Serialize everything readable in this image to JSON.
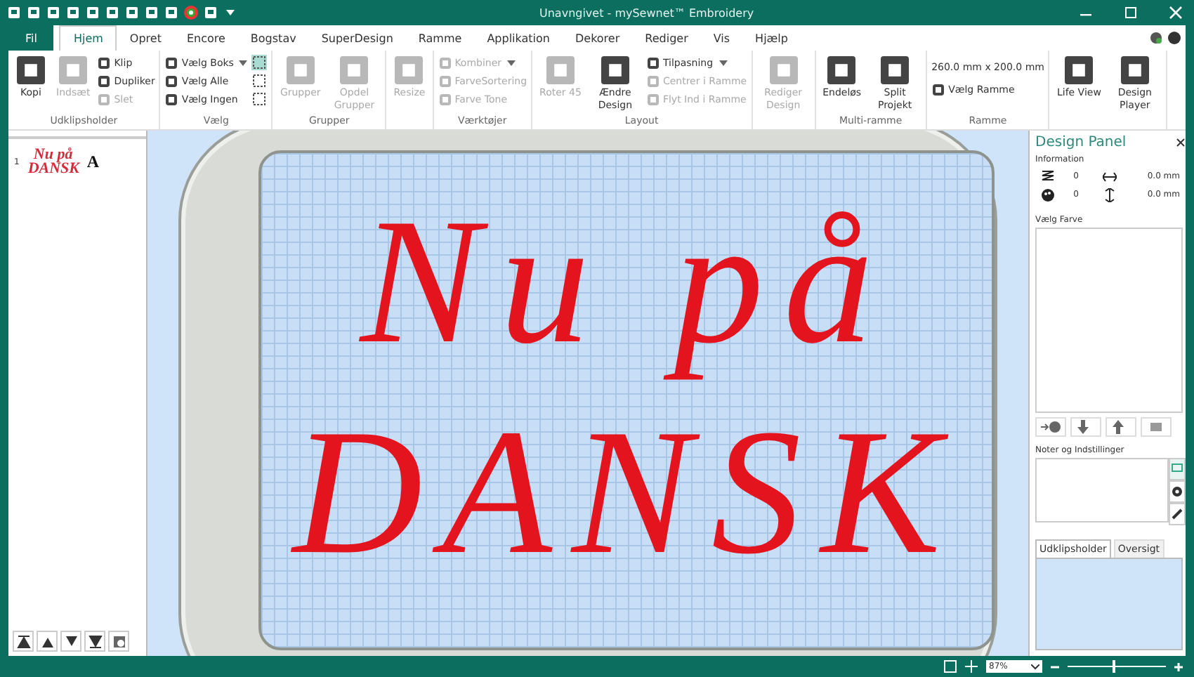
{
  "window": {
    "title": "Unavngivet -  mySewnet™ Embroidery"
  },
  "tabs": [
    {
      "label": "Fil",
      "kind": "file",
      "selected": false
    },
    {
      "label": "Hjem",
      "kind": "tab",
      "selected": true
    },
    {
      "label": "Opret",
      "kind": "tab",
      "selected": false
    },
    {
      "label": "Encore",
      "kind": "tab",
      "selected": false
    },
    {
      "label": "Bogstav",
      "kind": "tab",
      "selected": false
    },
    {
      "label": "SuperDesign",
      "kind": "tab",
      "selected": false
    },
    {
      "label": "Ramme",
      "kind": "tab",
      "selected": false
    },
    {
      "label": "Applikation",
      "kind": "tab",
      "selected": false
    },
    {
      "label": "Dekorer",
      "kind": "tab",
      "selected": false
    },
    {
      "label": "Rediger",
      "kind": "tab",
      "selected": false
    },
    {
      "label": "Vis",
      "kind": "tab",
      "selected": false
    },
    {
      "label": "Hjælp",
      "kind": "tab",
      "selected": false
    }
  ],
  "ribbon": [
    {
      "name": "Udklipsholder",
      "items": [
        {
          "kind": "large",
          "label": "Kopi",
          "disabled": false
        },
        {
          "kind": "large",
          "label": "Indsæt",
          "disabled": true
        },
        {
          "kind": "small",
          "label": "Klip",
          "disabled": false
        },
        {
          "kind": "small",
          "label": "Dupliker",
          "disabled": false
        },
        {
          "kind": "small",
          "label": "Slet",
          "disabled": true
        }
      ]
    },
    {
      "name": "Vælg",
      "items": [
        {
          "kind": "small",
          "label": "Vælg Boks",
          "disabled": false,
          "has_menu": true
        },
        {
          "kind": "small",
          "label": "Vælg Alle",
          "disabled": false
        },
        {
          "kind": "small",
          "label": "Vælg Ingen",
          "disabled": false
        },
        {
          "kind": "icon",
          "selected": true
        },
        {
          "kind": "icon",
          "selected": false
        },
        {
          "kind": "icon",
          "selected": false
        }
      ]
    },
    {
      "name": "Grupper",
      "items": [
        {
          "kind": "large",
          "label": "Grupper",
          "disabled": true
        },
        {
          "kind": "large",
          "label": "Opdel Grupper",
          "disabled": true
        }
      ]
    },
    {
      "items": [
        {
          "kind": "large",
          "label": "Resize",
          "disabled": true
        }
      ]
    },
    {
      "name": "Værktøjer",
      "items": [
        {
          "kind": "small",
          "label": "Kombiner",
          "disabled": true,
          "has_menu": true
        },
        {
          "kind": "small",
          "label": "FarveSortering",
          "disabled": true
        },
        {
          "kind": "small",
          "label": "Farve Tone",
          "disabled": true
        }
      ]
    },
    {
      "name": "Layout",
      "items": [
        {
          "kind": "large",
          "label": "Roter 45",
          "disabled": true
        },
        {
          "kind": "large",
          "label": "Ændre Design",
          "disabled": false
        },
        {
          "kind": "small",
          "label": "Tilpasning",
          "disabled": false,
          "has_menu": true
        },
        {
          "kind": "small",
          "label": "Centrer i Ramme",
          "disabled": true
        },
        {
          "kind": "small",
          "label": "Flyt Ind i Ramme",
          "disabled": true
        }
      ]
    },
    {
      "items": [
        {
          "kind": "large",
          "label": "Rediger Design",
          "disabled": true
        }
      ]
    },
    {
      "name": "Multi-ramme",
      "items": [
        {
          "kind": "large",
          "label": "Endeløs",
          "disabled": false
        },
        {
          "kind": "large",
          "label": "Split Projekt",
          "disabled": false
        }
      ]
    },
    {
      "name": "Ramme",
      "items": [
        {
          "kind": "text",
          "label": "260.0 mm x 200.0 mm"
        },
        {
          "kind": "small",
          "label": "Vælg Ramme",
          "disabled": false
        }
      ]
    },
    {
      "items": [
        {
          "kind": "large",
          "label": "Life View",
          "disabled": false
        },
        {
          "kind": "large",
          "label": "Design Player",
          "disabled": false
        }
      ]
    }
  ],
  "design_list": [
    {
      "number": "1",
      "thumbnail": "Nu på DANSK",
      "type_letter": "A"
    }
  ],
  "design": {
    "lines": [
      "Nu på",
      "DANSK"
    ]
  },
  "design_panel": {
    "title": "Design Panel",
    "information_label": "Information",
    "stats": [
      {
        "value": "0",
        "measure": "0.0 mm"
      },
      {
        "value": "0",
        "measure": "0.0 mm"
      }
    ],
    "color_label": "Vælg Farve",
    "notes_label": "Noter og Indstillinger",
    "tabs": [
      {
        "label": "Udklipsholder",
        "selected": true
      },
      {
        "label": "Oversigt",
        "selected": false
      }
    ]
  },
  "status_bar": {
    "zoom": "87%",
    "zoom_slider": {
      "level": 0.45
    }
  }
}
